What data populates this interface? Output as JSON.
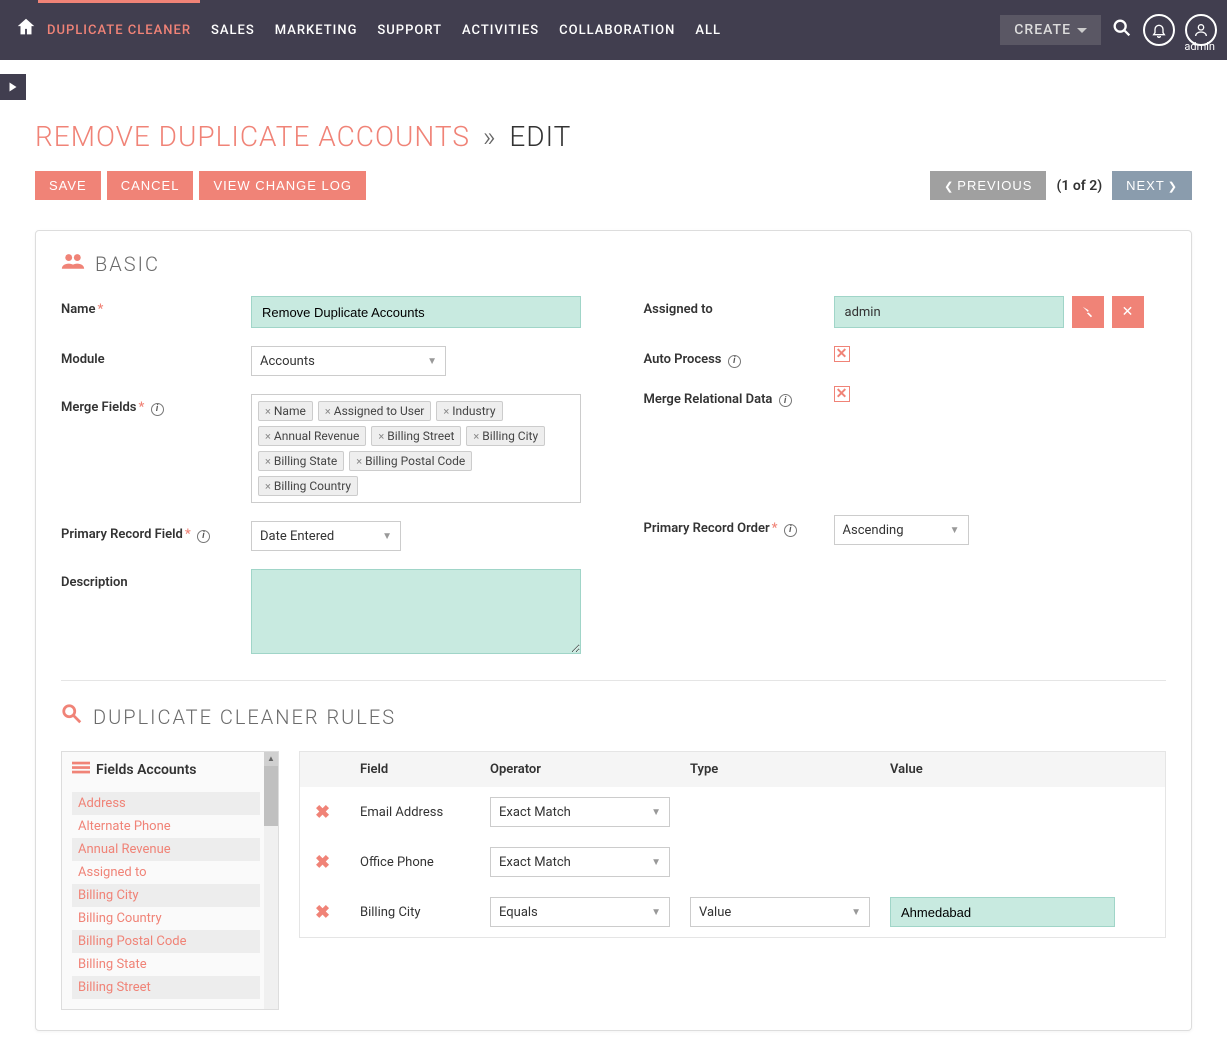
{
  "topbar": {
    "items": [
      {
        "label": "DUPLICATE CLEANER",
        "active": true
      },
      {
        "label": "SALES"
      },
      {
        "label": "MARKETING"
      },
      {
        "label": "SUPPORT"
      },
      {
        "label": "ACTIVITIES"
      },
      {
        "label": "COLLABORATION"
      },
      {
        "label": "ALL"
      }
    ],
    "create_label": "CREATE",
    "admin_label": "admin"
  },
  "page": {
    "title_main": "REMOVE DUPLICATE ACCOUNTS",
    "title_sep": "»",
    "title_sub": "EDIT"
  },
  "actions": {
    "save": "SAVE",
    "cancel": "CANCEL",
    "view_log": "VIEW CHANGE LOG",
    "previous": "PREVIOUS",
    "pager": "(1 of 2)",
    "next": "NEXT"
  },
  "basic": {
    "heading": "BASIC",
    "name_label": "Name",
    "name_value": "Remove Duplicate Accounts",
    "module_label": "Module",
    "module_value": "Accounts",
    "merge_fields_label": "Merge Fields",
    "merge_fields": [
      "Name",
      "Assigned to User",
      "Industry",
      "Annual Revenue",
      "Billing Street",
      "Billing City",
      "Billing State",
      "Billing Postal Code",
      "Billing Country"
    ],
    "primary_field_label": "Primary Record Field",
    "primary_field_value": "Date Entered",
    "description_label": "Description",
    "description_value": "",
    "assigned_label": "Assigned to",
    "assigned_value": "admin",
    "auto_process_label": "Auto Process",
    "merge_relational_label": "Merge Relational Data",
    "primary_order_label": "Primary Record Order",
    "primary_order_value": "Ascending"
  },
  "rules": {
    "heading": "DUPLICATE CLEANER RULES",
    "fields_panel_title": "Fields Accounts",
    "fields_list": [
      "Address",
      "Alternate Phone",
      "Annual Revenue",
      "Assigned to",
      "Billing City",
      "Billing Country",
      "Billing Postal Code",
      "Billing State",
      "Billing Street"
    ],
    "headers": {
      "field": "Field",
      "operator": "Operator",
      "type": "Type",
      "value": "Value"
    },
    "rows": [
      {
        "field": "Email Address",
        "operator": "Exact Match",
        "type": "",
        "value": ""
      },
      {
        "field": "Office Phone",
        "operator": "Exact Match",
        "type": "",
        "value": ""
      },
      {
        "field": "Billing City",
        "operator": "Equals",
        "type": "Value",
        "value": "Ahmedabad"
      }
    ]
  }
}
